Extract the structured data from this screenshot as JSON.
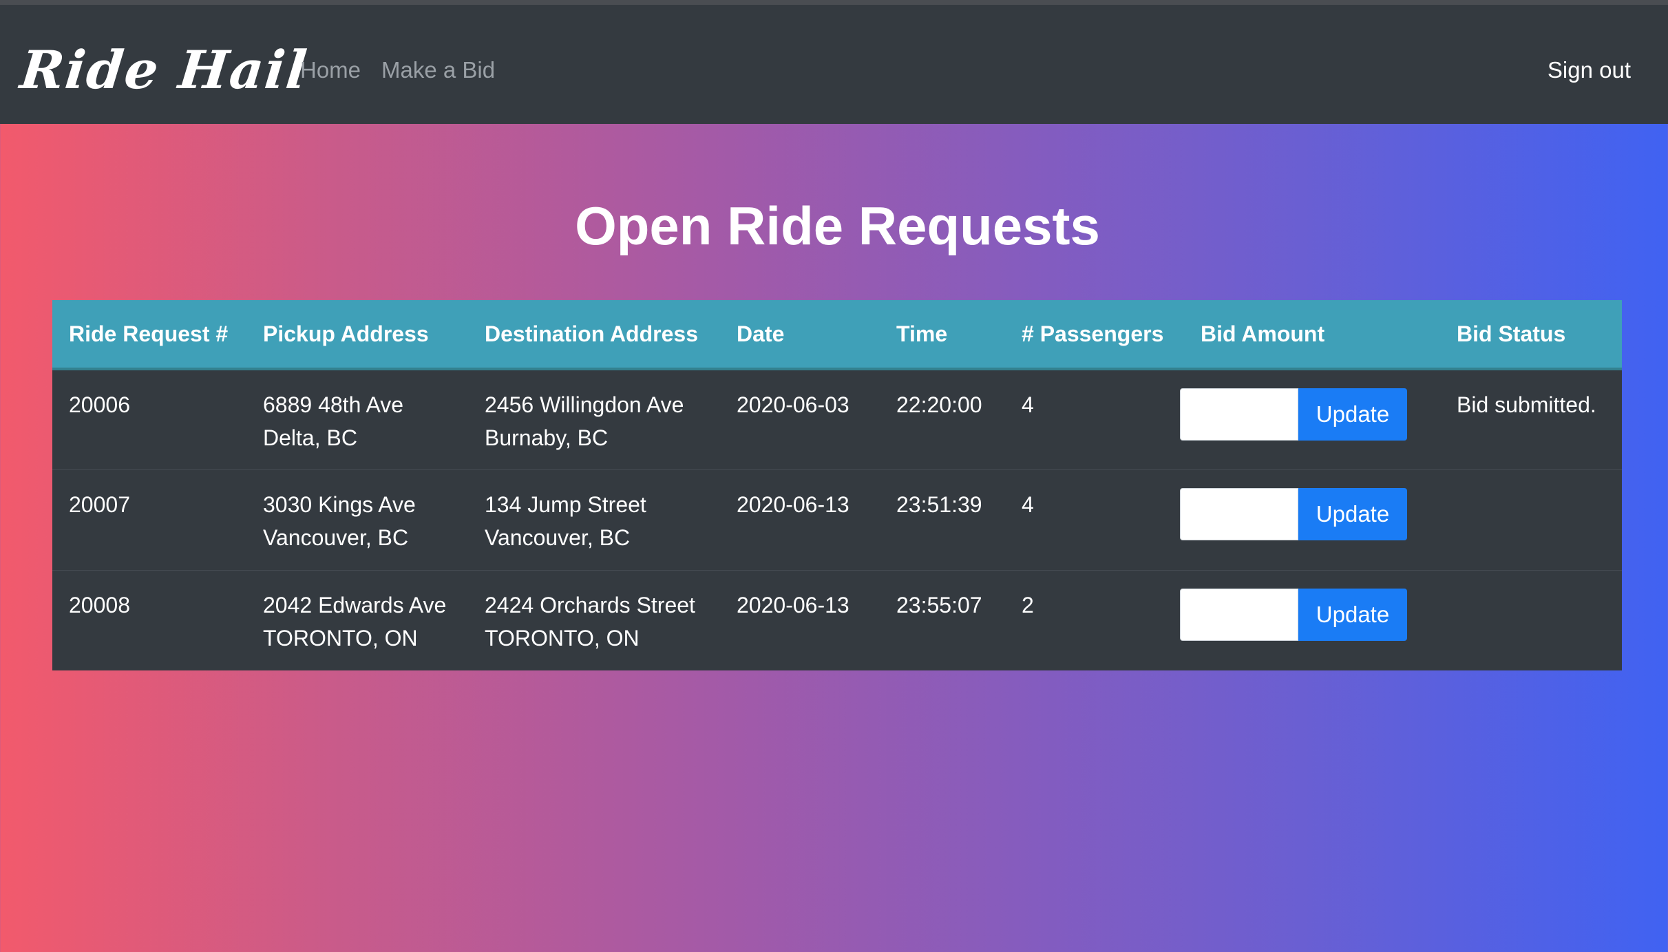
{
  "navbar": {
    "brand": "Ride Hail",
    "links": [
      "Home",
      "Make a Bid"
    ],
    "signout": "Sign out"
  },
  "page": {
    "title": "Open Ride Requests"
  },
  "table": {
    "headers": [
      "Ride Request #",
      "Pickup Address",
      "Destination Address",
      "Date",
      "Time",
      "# Passengers",
      "Bid Amount",
      "Bid Status"
    ],
    "rows": [
      {
        "id": "20006",
        "pickup_line1": "6889 48th Ave",
        "pickup_line2": "Delta, BC",
        "dest_line1": "2456 Willingdon Ave",
        "dest_line2": "Burnaby, BC",
        "date": "2020-06-03",
        "time": "22:20:00",
        "passengers": "4",
        "bid_value": "",
        "button": "Update",
        "status": "Bid submitted."
      },
      {
        "id": "20007",
        "pickup_line1": "3030 Kings Ave",
        "pickup_line2": "Vancouver, BC",
        "dest_line1": "134 Jump Street",
        "dest_line2": "Vancouver, BC",
        "date": "2020-06-13",
        "time": "23:51:39",
        "passengers": "4",
        "bid_value": "",
        "button": "Update",
        "status": ""
      },
      {
        "id": "20008",
        "pickup_line1": "2042 Edwards Ave",
        "pickup_line2": "TORONTO, ON",
        "dest_line1": "2424 Orchards Street",
        "dest_line2": "TORONTO, ON",
        "date": "2020-06-13",
        "time": "23:55:07",
        "passengers": "2",
        "bid_value": "",
        "button": "Update",
        "status": ""
      }
    ]
  },
  "colors": {
    "navbar": "#343a40",
    "table_header": "#3fa0b8",
    "button": "#1a7cf5",
    "gradient_start": "#f25a6c",
    "gradient_end": "#4062f2"
  }
}
